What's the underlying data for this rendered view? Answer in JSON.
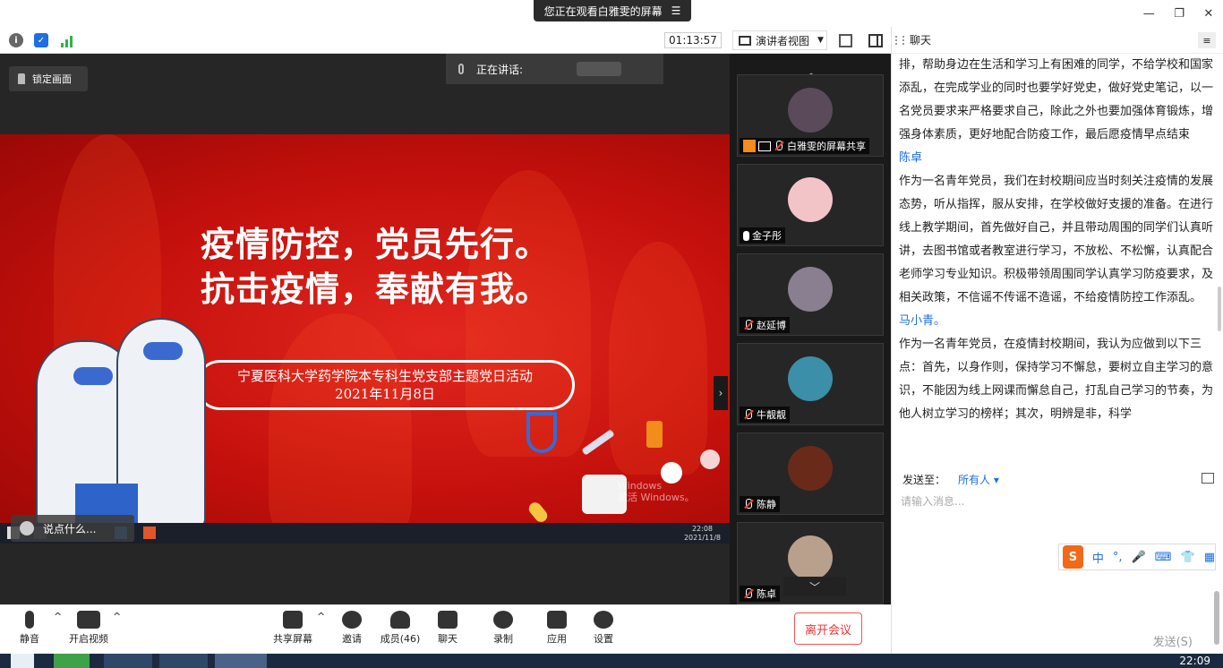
{
  "banner": {
    "text": "您正在观看白雅雯的屏幕",
    "menu_glyph": "☰"
  },
  "window_controls": {
    "minimize": "—",
    "restore": "❐",
    "close": "✕"
  },
  "meeting_bar": {
    "timer": "01:13:57",
    "view_label": "演讲者视图",
    "view_caret": "▼"
  },
  "stage": {
    "lock_label": "锁定画面",
    "speaking_label": "正在讲话:",
    "chat_hint": "说点什么...",
    "collapse_glyph": "›"
  },
  "slide": {
    "title_line1": "疫情防控，党员先行。",
    "title_line2": "抗击疫情，奉献有我。",
    "banner_line1": "宁夏医科大学药学院本专科生党支部主题党日活动",
    "banner_line2": "2021年11月8日",
    "watermark_line1": "Windows",
    "watermark_line2": "激活 Windows。",
    "remote_time": "22:08",
    "remote_date": "2021/11/8"
  },
  "gallery": {
    "up_glyph": "︿",
    "down_glyph": "﹀",
    "tiles": [
      {
        "name": "白雅雯的屏幕共享",
        "color": "#5a4a5a"
      },
      {
        "name": "金子彤",
        "color": "#f2c4c8"
      },
      {
        "name": "赵延博",
        "color": "#8a7f90"
      },
      {
        "name": "牛靓靓",
        "color": "#3c8fa8"
      },
      {
        "name": "陈静",
        "color": "#6a2a1a"
      },
      {
        "name": "陈卓",
        "color": "#b9a08c"
      }
    ]
  },
  "chat": {
    "title": "聊天",
    "menu_glyph": "≡",
    "messages": [
      {
        "sender": "",
        "text": "排，帮助身边在生活和学习上有困难的同学，不给学校和国家添乱，在完成学业的同时也要学好党史，做好党史笔记，以一名党员要求来严格要求自己，除此之外也要加强体育锻炼，增强身体素质，更好地配合防疫工作，最后愿疫情早点结束"
      },
      {
        "sender": "陈卓",
        "text": "作为一名青年党员，我们在封校期间应当时刻关注疫情的发展态势，听从指挥，服从安排，在学校做好支援的准备。在进行线上教学期间，首先做好自己，并且带动周围的同学们认真听讲，去图书馆或者教室进行学习，不放松、不松懈，认真配合老师学习专业知识。积极带领周围同学认真学习防疫要求，及相关政策，不信谣不传谣不造谣，不给疫情防控工作添乱。"
      },
      {
        "sender": "马小青。",
        "text": "作为一名青年党员，在疫情封校期间，我认为应做到以下三点：首先，以身作则，保持学习不懈怠，要树立自主学习的意识，不能因为线上网课而懈怠自己，打乱自己学习的节奏，为他人树立学习的榜样；其次，明辨是非，科学"
      }
    ],
    "send_to_label": "发送至：",
    "send_to_target": "所有人 ▾",
    "input_placeholder": "请输入消息...",
    "send_label": "发送(S)",
    "ime": {
      "logo": "S",
      "items": [
        "中",
        "°,",
        "🎤",
        "⌨",
        "👕",
        "▦"
      ]
    }
  },
  "toolbar": {
    "mute": "静音",
    "video": "开启视频",
    "share": "共享屏幕",
    "invite": "邀请",
    "members": "成员(46)",
    "chat": "聊天",
    "record": "录制",
    "apps": "应用",
    "settings": "设置",
    "leave": "离开会议",
    "caret": "^"
  },
  "os": {
    "clock": "22:09"
  }
}
